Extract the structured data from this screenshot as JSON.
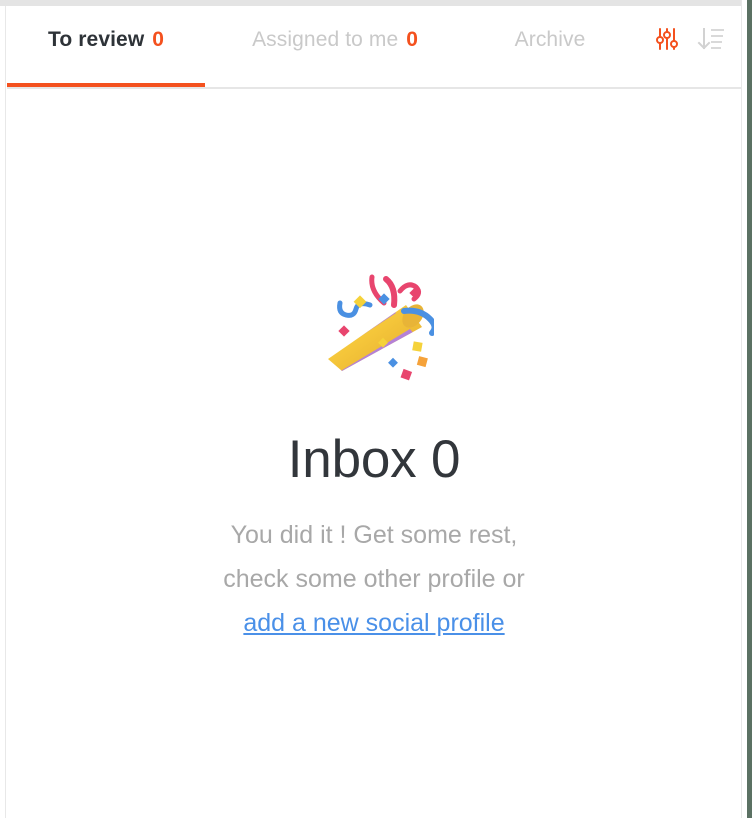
{
  "window": {
    "accent_color": "#f4511e",
    "link_color": "#4a90e8",
    "muted_color": "#c9c9c9"
  },
  "tabs": [
    {
      "id": "to-review",
      "label": "To review",
      "count": "0",
      "active": true,
      "has_count": true
    },
    {
      "id": "assigned",
      "label": "Assigned to me",
      "count": "0",
      "active": false,
      "has_count": true
    },
    {
      "id": "archive",
      "label": "Archive",
      "count": "",
      "active": false,
      "has_count": false
    }
  ],
  "toolbar": {
    "filter_icon": "filter-sliders-icon",
    "sort_icon": "sort-descending-icon"
  },
  "empty_state": {
    "emoji": "party-popper-emoji",
    "title": "Inbox 0",
    "line1": "You did it ! Get some rest,",
    "line2": "check some other profile or",
    "link": "add a new social profile"
  }
}
